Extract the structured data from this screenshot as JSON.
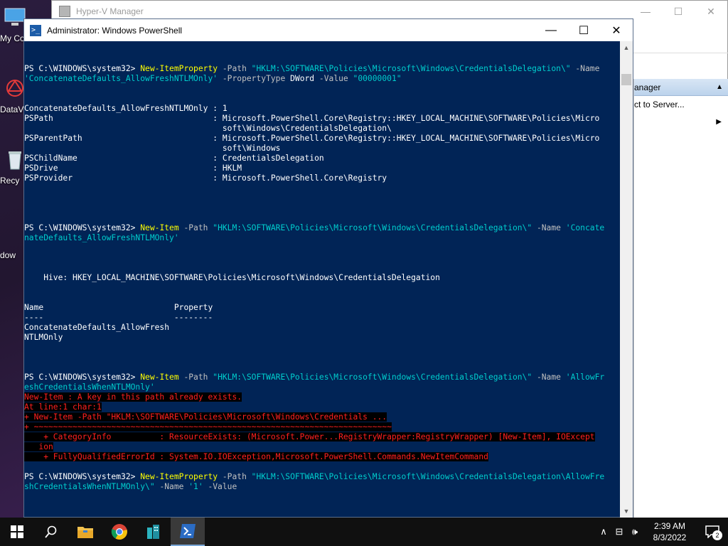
{
  "desktop": {
    "icons": [
      {
        "label": "My Co",
        "icon": "computer-icon"
      },
      {
        "label": "DataV",
        "icon": "datav-icon"
      },
      {
        "label": "Recy",
        "icon": "recycle-bin-icon"
      },
      {
        "label": "dow",
        "icon": "download-icon"
      }
    ]
  },
  "hyperv": {
    "title": "Hyper-V Manager",
    "actions_header": "anager",
    "actions": [
      {
        "label": "ct to Server..."
      },
      {
        "label": ""
      }
    ]
  },
  "powershell": {
    "title": "Administrator: Windows PowerShell",
    "lines": [
      [],
      [],
      [
        {
          "t": "PS C:\\WINDOWS\\system32> ",
          "c": ""
        },
        {
          "t": "New-ItemProperty",
          "c": "cmd"
        },
        {
          "t": " -Path ",
          "c": "param"
        },
        {
          "t": "\"HKLM:\\SOFTWARE\\Policies\\Microsoft\\Windows\\CredentialsDelegation\\\"",
          "c": "str"
        },
        {
          "t": " -Name",
          "c": "param"
        }
      ],
      [
        {
          "t": "'ConcatenateDefaults_AllowFreshNTLMOnly'",
          "c": "str"
        },
        {
          "t": " -PropertyType ",
          "c": "param"
        },
        {
          "t": "DWord",
          "c": ""
        },
        {
          "t": " -Value ",
          "c": "param"
        },
        {
          "t": "\"00000001\"",
          "c": "str"
        }
      ],
      [],
      [],
      [
        {
          "t": "ConcatenateDefaults_AllowFreshNTLMOnly : 1",
          "c": ""
        }
      ],
      [
        {
          "t": "PSPath                                 : Microsoft.PowerShell.Core\\Registry::HKEY_LOCAL_MACHINE\\SOFTWARE\\Policies\\Micro",
          "c": ""
        }
      ],
      [
        {
          "t": "                                         soft\\Windows\\CredentialsDelegation\\",
          "c": ""
        }
      ],
      [
        {
          "t": "PSParentPath                           : Microsoft.PowerShell.Core\\Registry::HKEY_LOCAL_MACHINE\\SOFTWARE\\Policies\\Micro",
          "c": ""
        }
      ],
      [
        {
          "t": "                                         soft\\Windows",
          "c": ""
        }
      ],
      [
        {
          "t": "PSChildName                            : CredentialsDelegation",
          "c": ""
        }
      ],
      [
        {
          "t": "PSDrive                                : HKLM",
          "c": ""
        }
      ],
      [
        {
          "t": "PSProvider                             : Microsoft.PowerShell.Core\\Registry",
          "c": ""
        }
      ],
      [],
      [],
      [],
      [],
      [
        {
          "t": "PS C:\\WINDOWS\\system32> ",
          "c": ""
        },
        {
          "t": "New-Item",
          "c": "cmd"
        },
        {
          "t": " -Path ",
          "c": "param"
        },
        {
          "t": "\"HKLM:\\SOFTWARE\\Policies\\Microsoft\\Windows\\CredentialsDelegation\\\"",
          "c": "str"
        },
        {
          "t": " -Name ",
          "c": "param"
        },
        {
          "t": "'Concate",
          "c": "str"
        }
      ],
      [
        {
          "t": "nateDefaults_AllowFreshNTLMOnly'",
          "c": "str"
        }
      ],
      [],
      [],
      [],
      [
        {
          "t": "    Hive: HKEY_LOCAL_MACHINE\\SOFTWARE\\Policies\\Microsoft\\Windows\\CredentialsDelegation",
          "c": ""
        }
      ],
      [],
      [],
      [
        {
          "t": "Name                           Property",
          "c": ""
        }
      ],
      [
        {
          "t": "----                           --------",
          "c": ""
        }
      ],
      [
        {
          "t": "ConcatenateDefaults_AllowFresh",
          "c": ""
        }
      ],
      [
        {
          "t": "NTLMOnly",
          "c": ""
        }
      ],
      [],
      [],
      [],
      [
        {
          "t": "PS C:\\WINDOWS\\system32> ",
          "c": ""
        },
        {
          "t": "New-Item",
          "c": "cmd"
        },
        {
          "t": " -Path ",
          "c": "param"
        },
        {
          "t": "\"HKLM:\\SOFTWARE\\Policies\\Microsoft\\Windows\\CredentialsDelegation\\\"",
          "c": "str"
        },
        {
          "t": " -Name ",
          "c": "param"
        },
        {
          "t": "'AllowFr",
          "c": "str"
        }
      ],
      [
        {
          "t": "eshCredentialsWhenNTLMOnly'",
          "c": "str"
        }
      ],
      [
        {
          "t": "New-Item : A key in this path already exists.",
          "c": "err"
        }
      ],
      [
        {
          "t": "At line:1 char:1",
          "c": "err"
        }
      ],
      [
        {
          "t": "+ New-Item -Path \"HKLM:\\SOFTWARE\\Policies\\Microsoft\\Windows\\Credentials ...",
          "c": "err"
        }
      ],
      [
        {
          "t": "+ ~~~~~~~~~~~~~~~~~~~~~~~~~~~~~~~~~~~~~~~~~~~~~~~~~~~~~~~~~~~~~~~~~~~~~~~~~~",
          "c": "err"
        }
      ],
      [
        {
          "t": "    + CategoryInfo          : ResourceExists: (Microsoft.Power...RegistryWrapper:RegistryWrapper) [New-Item], IOExcept",
          "c": "err"
        }
      ],
      [
        {
          "t": "   ion",
          "c": "err"
        }
      ],
      [
        {
          "t": "    + FullyQualifiedErrorId : System.IO.IOException,Microsoft.PowerShell.Commands.NewItemCommand",
          "c": "err"
        }
      ],
      [
        {
          "t": "",
          "c": ""
        }
      ],
      [
        {
          "t": "PS C:\\WINDOWS\\system32> ",
          "c": ""
        },
        {
          "t": "New-ItemProperty",
          "c": "cmd"
        },
        {
          "t": " -Path ",
          "c": "param"
        },
        {
          "t": "\"HKLM:\\SOFTWARE\\Policies\\Microsoft\\Windows\\CredentialsDelegation\\AllowFre",
          "c": "str"
        }
      ],
      [
        {
          "t": "shCredentialsWhenNTLMOnly\\\"",
          "c": "str"
        },
        {
          "t": " -Name ",
          "c": "param"
        },
        {
          "t": "'1'",
          "c": "str"
        },
        {
          "t": " -Value",
          "c": "param"
        }
      ]
    ]
  },
  "taskbar": {
    "apps": [
      {
        "name": "start-button",
        "icon": "windows-logo-icon"
      },
      {
        "name": "search-button",
        "icon": "search-icon"
      },
      {
        "name": "file-explorer-button",
        "icon": "folder-icon"
      },
      {
        "name": "chrome-button",
        "icon": "chrome-icon"
      },
      {
        "name": "buildings-app-button",
        "icon": "buildings-icon"
      },
      {
        "name": "powershell-button",
        "icon": "powershell-icon"
      }
    ],
    "time": "2:39 AM",
    "date": "8/3/2022",
    "notification_count": "2"
  },
  "colors": {
    "ps_background": "#012456",
    "command": "#ffff00",
    "string": "#00cdcd",
    "error": "#ff2020"
  }
}
